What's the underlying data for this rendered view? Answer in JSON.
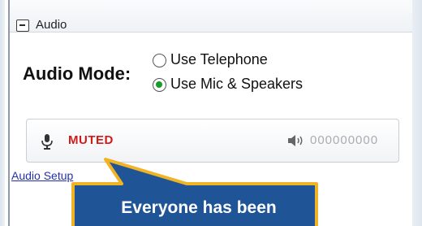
{
  "panel": {
    "title": "Audio",
    "collapse_icon": "minus-box-icon"
  },
  "audio_mode": {
    "label": "Audio Mode:",
    "options": [
      {
        "label": "Use Telephone",
        "selected": false
      },
      {
        "label": "Use Mic & Speakers",
        "selected": true
      }
    ]
  },
  "status": {
    "mic_icon": "microphone-icon",
    "muted_text": "MUTED",
    "speaker_icon": "speaker-icon",
    "level_text": "000000000",
    "muted_color": "#d11a1a"
  },
  "links": {
    "audio_setup": "Audio Setup"
  },
  "callout": {
    "text": "Everyone has been",
    "fill": "#1f5597",
    "border": "#f0b323"
  }
}
